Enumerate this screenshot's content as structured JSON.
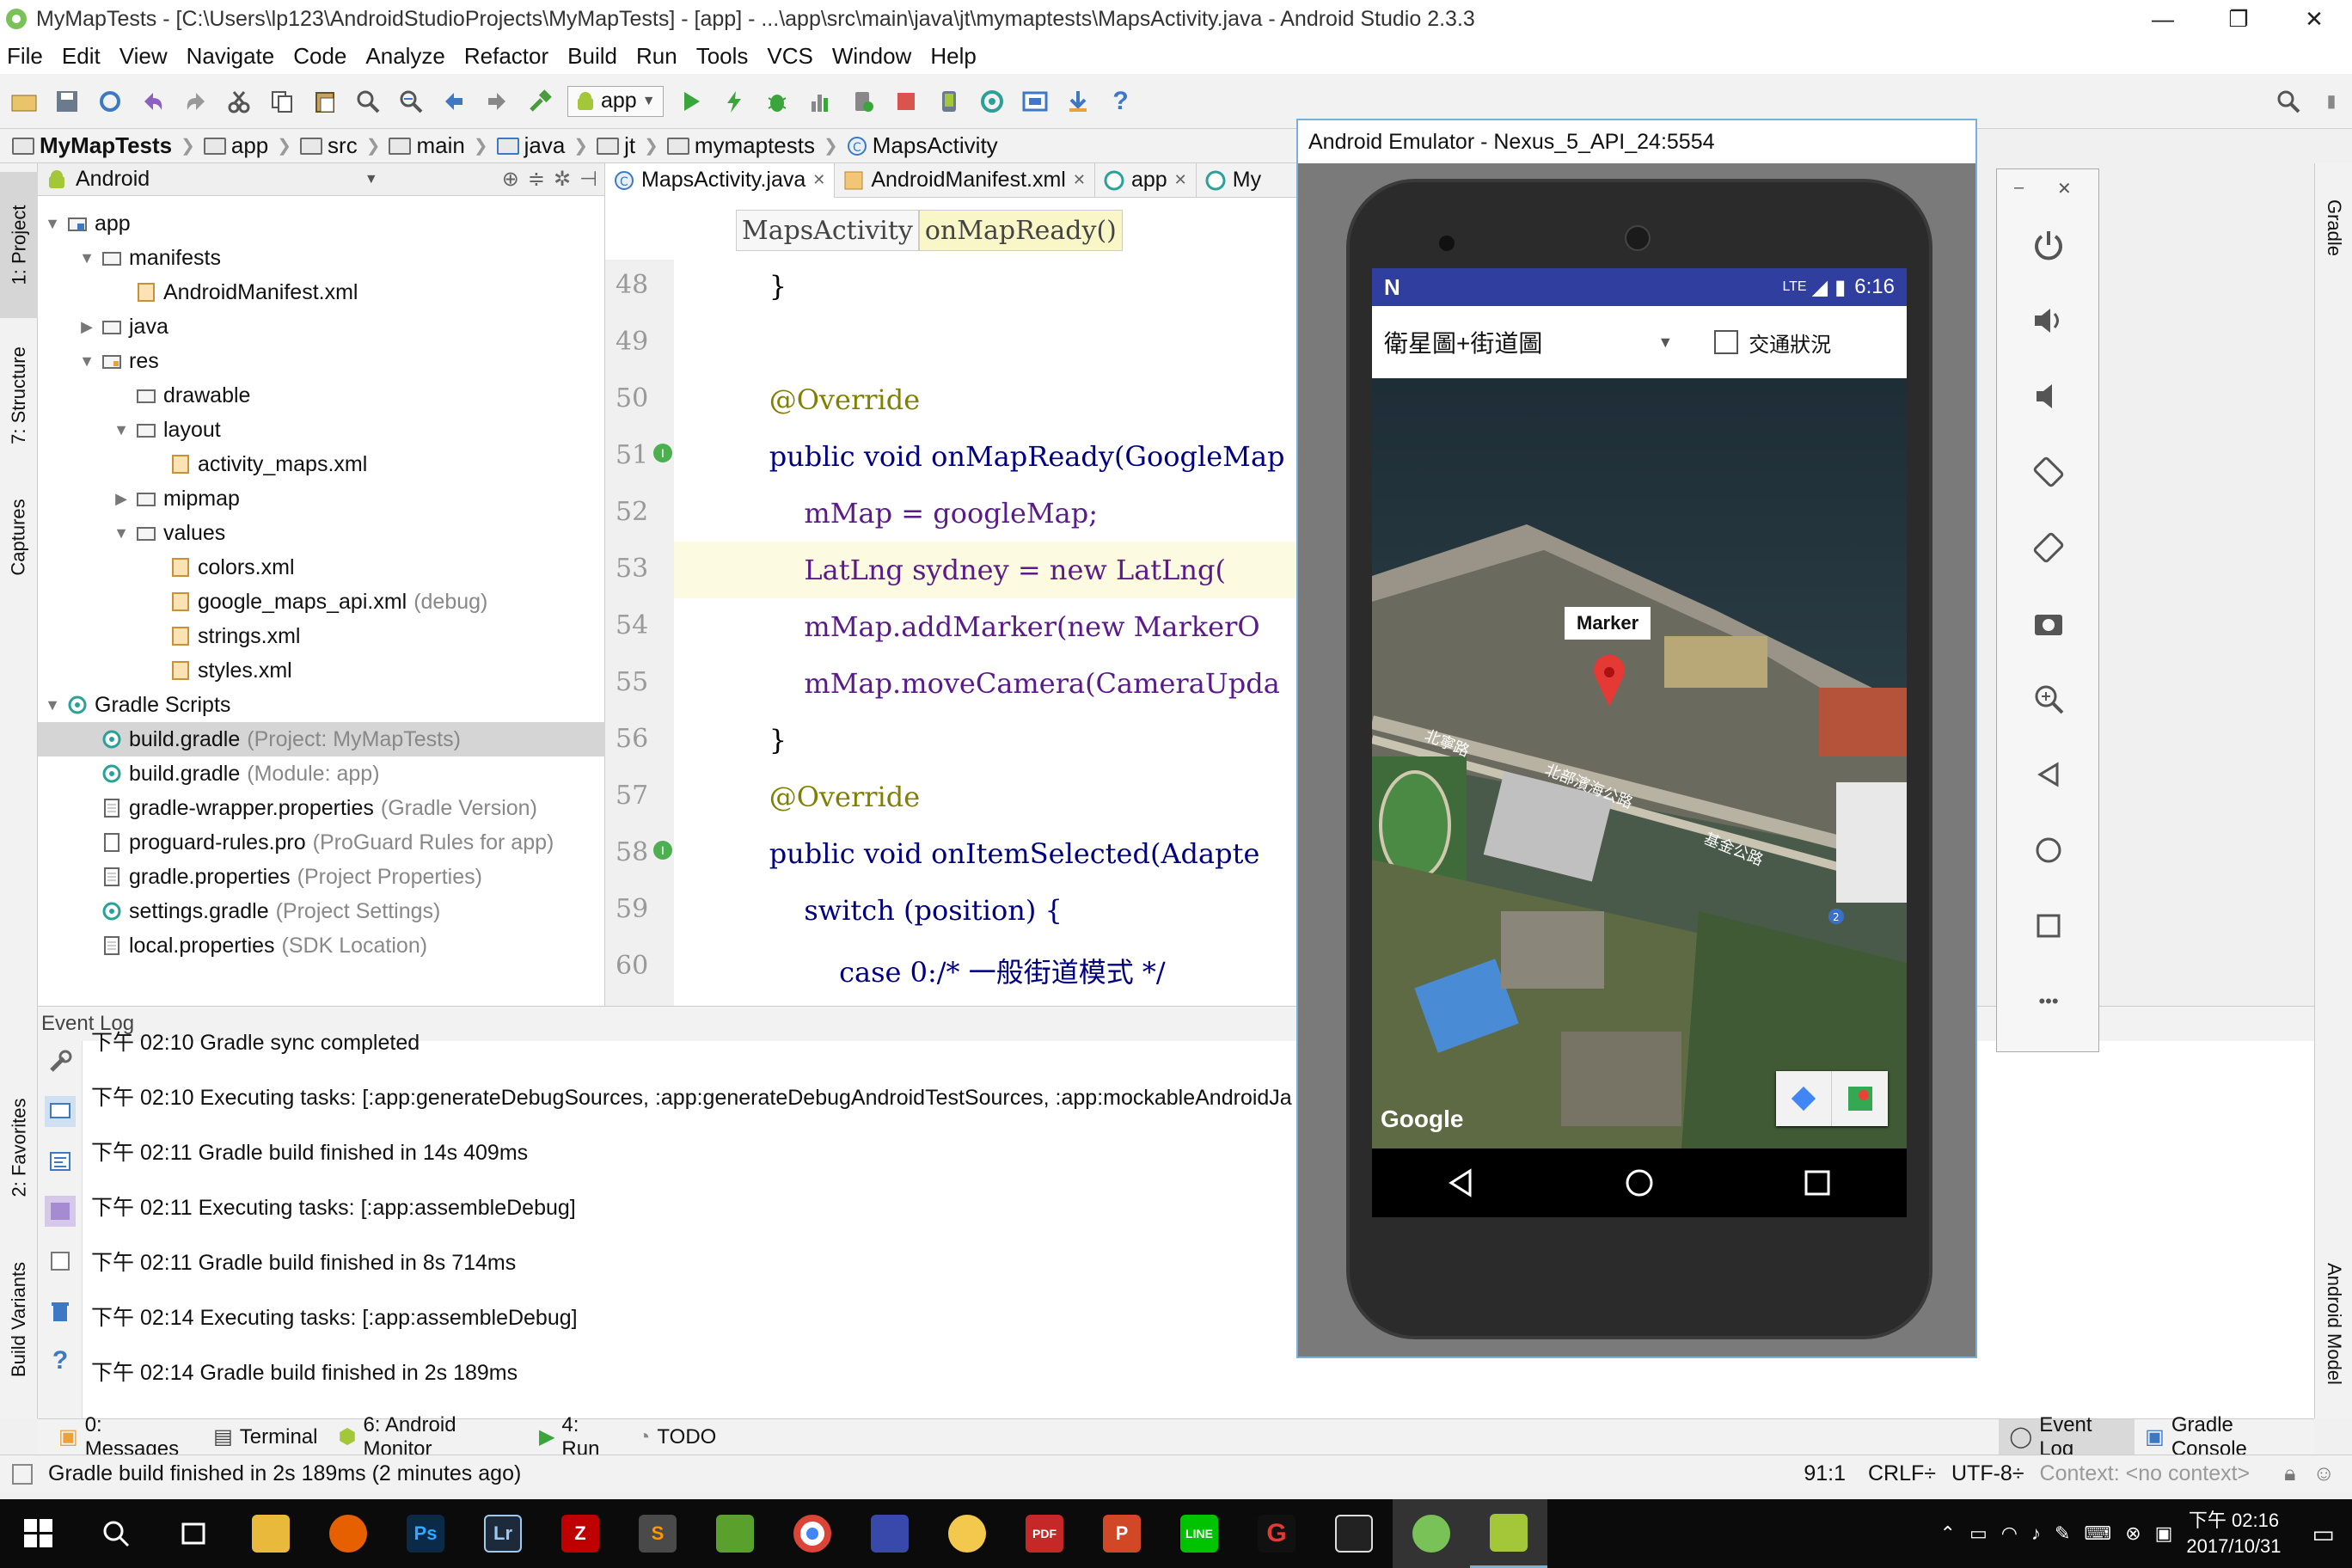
{
  "window": {
    "title": "MyMapTests - [C:\\Users\\lp123\\AndroidStudioProjects\\MyMapTests] - [app] - ...\\app\\src\\main\\java\\jt\\mymaptests\\MapsActivity.java - Android Studio 2.3.3",
    "minimize": "—",
    "restore": "❐",
    "close": "✕"
  },
  "menu": [
    "File",
    "Edit",
    "View",
    "Navigate",
    "Code",
    "Analyze",
    "Refactor",
    "Build",
    "Run",
    "Tools",
    "VCS",
    "Window",
    "Help"
  ],
  "toolbar": {
    "run_config": "app"
  },
  "breadcrumbs": [
    "MyMapTests",
    "app",
    "src",
    "main",
    "java",
    "jt",
    "mymaptests",
    "MapsActivity"
  ],
  "left_stripe": {
    "project": "1: Project",
    "structure": "7: Structure",
    "captures": "Captures",
    "favorites": "2: Favorites",
    "build_variants": "Build Variants"
  },
  "right_stripe": {
    "gradle": "Gradle",
    "android_model": "Android Model"
  },
  "project_panel": {
    "view_mode": "Android",
    "tree": [
      {
        "label": "app",
        "sub": "",
        "level": 0,
        "arrow": "▼",
        "icon": "folder-module"
      },
      {
        "label": "manifests",
        "sub": "",
        "level": 1,
        "arrow": "▼",
        "icon": "folder"
      },
      {
        "label": "AndroidManifest.xml",
        "sub": "",
        "level": 2,
        "arrow": "",
        "icon": "xml"
      },
      {
        "label": "java",
        "sub": "",
        "level": 1,
        "arrow": "▶",
        "icon": "folder"
      },
      {
        "label": "res",
        "sub": "",
        "level": 1,
        "arrow": "▼",
        "icon": "folder-res"
      },
      {
        "label": "drawable",
        "sub": "",
        "level": 2,
        "arrow": "",
        "icon": "folder"
      },
      {
        "label": "layout",
        "sub": "",
        "level": 2,
        "arrow": "▼",
        "icon": "folder"
      },
      {
        "label": "activity_maps.xml",
        "sub": "",
        "level": 3,
        "arrow": "",
        "icon": "xml"
      },
      {
        "label": "mipmap",
        "sub": "",
        "level": 2,
        "arrow": "▶",
        "icon": "folder"
      },
      {
        "label": "values",
        "sub": "",
        "level": 2,
        "arrow": "▼",
        "icon": "folder"
      },
      {
        "label": "colors.xml",
        "sub": "",
        "level": 3,
        "arrow": "",
        "icon": "xml"
      },
      {
        "label": "google_maps_api.xml",
        "sub": "(debug)",
        "level": 3,
        "arrow": "",
        "icon": "xml"
      },
      {
        "label": "strings.xml",
        "sub": "",
        "level": 3,
        "arrow": "",
        "icon": "xml"
      },
      {
        "label": "styles.xml",
        "sub": "",
        "level": 3,
        "arrow": "",
        "icon": "xml"
      },
      {
        "label": "Gradle Scripts",
        "sub": "",
        "level": 0,
        "arrow": "▼",
        "icon": "gradle"
      },
      {
        "label": "build.gradle",
        "sub": "(Project: MyMapTests)",
        "level": 1,
        "arrow": "",
        "icon": "gradle"
      },
      {
        "label": "build.gradle",
        "sub": "(Module: app)",
        "level": 1,
        "arrow": "",
        "icon": "gradle"
      },
      {
        "label": "gradle-wrapper.properties",
        "sub": "(Gradle Version)",
        "level": 1,
        "arrow": "",
        "icon": "props"
      },
      {
        "label": "proguard-rules.pro",
        "sub": "(ProGuard Rules for app)",
        "level": 1,
        "arrow": "",
        "icon": "file"
      },
      {
        "label": "gradle.properties",
        "sub": "(Project Properties)",
        "level": 1,
        "arrow": "",
        "icon": "props"
      },
      {
        "label": "settings.gradle",
        "sub": "(Project Settings)",
        "level": 1,
        "arrow": "",
        "icon": "gradle"
      },
      {
        "label": "local.properties",
        "sub": "(SDK Location)",
        "level": 1,
        "arrow": "",
        "icon": "props"
      }
    ]
  },
  "editor": {
    "tabs": [
      {
        "label": "MapsActivity.java",
        "close": "✕",
        "icon": "class"
      },
      {
        "label": "AndroidManifest.xml",
        "close": "✕",
        "icon": "xml"
      },
      {
        "label": "app",
        "close": "✕",
        "icon": "gradle"
      },
      {
        "label": "My",
        "close": "",
        "icon": "gradle"
      }
    ],
    "crumbs": [
      "MapsActivity",
      "onMapReady()"
    ],
    "lines": [
      {
        "n": "48",
        "code": "    }"
      },
      {
        "n": "49",
        "code": ""
      },
      {
        "n": "50",
        "code": "    @Override"
      },
      {
        "n": "51",
        "code": "    public void onMapReady(GoogleMap"
      },
      {
        "n": "52",
        "code": "        mMap = googleMap;"
      },
      {
        "n": "53",
        "code": "        LatLng sydney = new LatLng("
      },
      {
        "n": "54",
        "code": "        mMap.addMarker(new MarkerO"
      },
      {
        "n": "55",
        "code": "        mMap.moveCamera(CameraUpda"
      },
      {
        "n": "56",
        "code": "    }"
      },
      {
        "n": "57",
        "code": "    @Override"
      },
      {
        "n": "58",
        "code": "    public void onItemSelected(Adapte"
      },
      {
        "n": "59",
        "code": "        switch (position) {"
      },
      {
        "n": "60",
        "code": "            case 0:/* 一般街道模式 */"
      }
    ]
  },
  "event_log": {
    "title": "Event Log",
    "entries": [
      "下午 02:10 Gradle sync completed",
      "下午 02:10 Executing tasks: [:app:generateDebugSources, :app:generateDebugAndroidTestSources, :app:mockableAndroidJa",
      "下午 02:11 Gradle build finished in 14s 409ms",
      "下午 02:11 Executing tasks: [:app:assembleDebug]",
      "下午 02:11 Gradle build finished in 8s 714ms",
      "下午 02:14 Executing tasks: [:app:assembleDebug]",
      "下午 02:14 Gradle build finished in 2s 189ms"
    ]
  },
  "bottom_tools": {
    "messages": "0: Messages",
    "terminal": "Terminal",
    "android_monitor": "6: Android Monitor",
    "run": "4: Run",
    "todo": "TODO",
    "event_log": "Event Log",
    "gradle_console": "Gradle Console"
  },
  "status_bar": {
    "message": "Gradle build finished in 2s 189ms (2 minutes ago)",
    "position": "91:1",
    "line_sep": "CRLF÷",
    "encoding": "UTF-8÷",
    "context": "Context: <no context>"
  },
  "emulator": {
    "title": "Android Emulator - Nexus_5_API_24:5554",
    "status_time": "6:16",
    "status_net": "LTE",
    "map_type": "衛星圖+街道圖",
    "traffic_label": "交通狀況",
    "traffic_checked": false,
    "marker_title": "Marker",
    "google_logo": "Google",
    "roads": [
      "北寧路",
      "北部濱海公路",
      "基金公路"
    ],
    "route_badge": "2",
    "side_minimize": "–",
    "side_close": "✕",
    "side_more": "•••"
  },
  "taskbar": {
    "time": "下午 02:16",
    "date": "2017/10/31"
  }
}
